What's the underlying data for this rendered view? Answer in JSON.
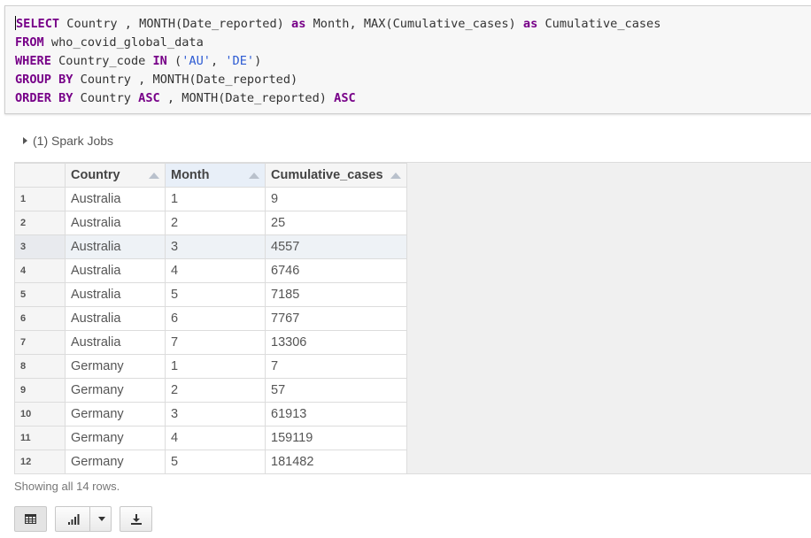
{
  "query": {
    "lines": [
      [
        {
          "t": "SELECT",
          "k": "kw"
        },
        {
          "t": " Country , MONTH(Date_reported) "
        },
        {
          "t": "as",
          "k": "kw"
        },
        {
          "t": " Month, MAX(Cumulative_cases) "
        },
        {
          "t": "as",
          "k": "kw"
        },
        {
          "t": " Cumulative_cases"
        }
      ],
      [
        {
          "t": "FROM",
          "k": "kw"
        },
        {
          "t": " who_covid_global_data"
        }
      ],
      [
        {
          "t": "WHERE",
          "k": "kw"
        },
        {
          "t": " Country_code "
        },
        {
          "t": "IN",
          "k": "kw"
        },
        {
          "t": " ("
        },
        {
          "t": "'AU'",
          "k": "str"
        },
        {
          "t": ", "
        },
        {
          "t": "'DE'",
          "k": "str"
        },
        {
          "t": ")"
        }
      ],
      [
        {
          "t": "GROUP BY",
          "k": "kw"
        },
        {
          "t": " Country , MONTH(Date_reported)"
        }
      ],
      [
        {
          "t": "ORDER BY",
          "k": "kw"
        },
        {
          "t": " Country "
        },
        {
          "t": "ASC",
          "k": "kw"
        },
        {
          "t": " , MONTH(Date_reported) "
        },
        {
          "t": "ASC",
          "k": "kw"
        }
      ]
    ]
  },
  "spark_jobs": {
    "label": "(1) Spark Jobs"
  },
  "results": {
    "columns": [
      "Country",
      "Month",
      "Cumulative_cases"
    ],
    "sorted_column": "Month",
    "highlighted_row": 3,
    "rows": [
      [
        "1",
        "Australia",
        "1",
        "9"
      ],
      [
        "2",
        "Australia",
        "2",
        "25"
      ],
      [
        "3",
        "Australia",
        "3",
        "4557"
      ],
      [
        "4",
        "Australia",
        "4",
        "6746"
      ],
      [
        "5",
        "Australia",
        "5",
        "7185"
      ],
      [
        "6",
        "Australia",
        "6",
        "7767"
      ],
      [
        "7",
        "Australia",
        "7",
        "13306"
      ],
      [
        "8",
        "Germany",
        "1",
        "7"
      ],
      [
        "9",
        "Germany",
        "2",
        "57"
      ],
      [
        "10",
        "Germany",
        "3",
        "61913"
      ],
      [
        "11",
        "Germany",
        "4",
        "159119"
      ],
      [
        "12",
        "Germany",
        "5",
        "181482"
      ]
    ]
  },
  "footer": {
    "showing": "Showing all 14 rows."
  },
  "toolbar": {
    "table_icon": "table-icon",
    "chart_icon": "bar-chart-icon",
    "download_icon": "download-icon"
  },
  "colors": {
    "keyword": "#770088",
    "string": "#2d5bd3"
  }
}
